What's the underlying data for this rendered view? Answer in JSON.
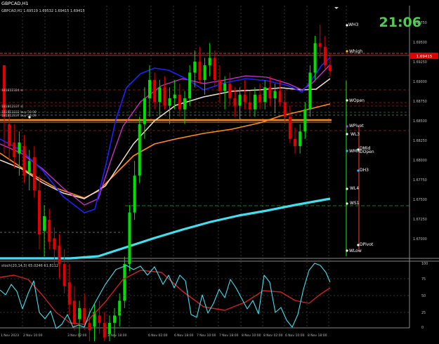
{
  "header": {
    "symbol_title": "GBPCAD,H1",
    "ohlc_text": "GBPCAD,H1  1.69519 1.69532 1.69415 1.69415"
  },
  "clock": {
    "time": "21:06"
  },
  "oscillator": {
    "label": "stoch(20,14,3) 65.0246 61.8112"
  },
  "trade_labels": [
    "181812324 sl",
    "181812337 sl",
    "181812322 buy 50.09",
    "181812337 buy 50.09"
  ],
  "level_labels": [
    "WH3",
    "Whigh",
    "WOpen",
    "WPivot",
    "WL3",
    "WMid",
    "DMid",
    "DOpen",
    "DH3",
    "WL4",
    "WS1",
    "DPivot",
    "WLow"
  ],
  "price_axis": [
    "1.69750",
    "1.69500",
    "1.69250",
    "1.69000",
    "1.68750",
    "1.68500",
    "1.68250",
    "1.68000",
    "1.67750",
    "1.67500",
    "1.67250",
    "1.67000"
  ],
  "current_price": "1.69415",
  "osc_axis": [
    "100",
    "75",
    "50",
    "25",
    "0"
  ],
  "time_axis": [
    "1 Nov 2023",
    "2 Nov 10:00",
    "3 Nov 02:00",
    "3 Nov 18:00",
    "6 Nov 02:00",
    "6 Nov 18:00",
    "7 Nov 10:00",
    "7 Nov 18:00",
    "8 Nov 10:00",
    "8 Nov 02:00",
    "6 Nov 10:00",
    "8 Nov 18:00"
  ],
  "colors": {
    "bull": "#00e000",
    "bear": "#e00000",
    "ma_blue": "#2020ff",
    "ma_magenta": "#d030d0",
    "ma_white": "#f0e0d0",
    "ma_orange": "#ff8c1a",
    "ma_cyan": "#40e0f0",
    "clock": "#4cd04c"
  },
  "chart_data": {
    "type": "candlestick",
    "candles": [
      [
        1.695,
        1.69,
        1.683,
        1.688
      ],
      [
        1.687,
        1.689,
        1.682,
        1.684
      ],
      [
        1.6845,
        1.687,
        1.681,
        1.6825
      ],
      [
        1.683,
        1.686,
        1.68,
        1.6845
      ],
      [
        1.684,
        1.6855,
        1.679,
        1.68
      ],
      [
        1.6805,
        1.6835,
        1.678,
        1.682
      ],
      [
        1.6825,
        1.684,
        1.677,
        1.678
      ],
      [
        1.678,
        1.68,
        1.67,
        1.672
      ],
      [
        1.6725,
        1.676,
        1.669,
        1.6745
      ],
      [
        1.674,
        1.6755,
        1.67,
        1.671
      ],
      [
        1.6715,
        1.673,
        1.668,
        1.67
      ],
      [
        1.6705,
        1.672,
        1.666,
        1.668
      ],
      [
        1.668,
        1.67,
        1.664,
        1.665
      ],
      [
        1.6655,
        1.668,
        1.661,
        1.6625
      ],
      [
        1.663,
        1.665,
        1.659,
        1.66
      ],
      [
        1.6605,
        1.663,
        1.658,
        1.662
      ],
      [
        1.662,
        1.664,
        1.659,
        1.66
      ],
      [
        1.66,
        1.662,
        1.657,
        1.659
      ],
      [
        1.6595,
        1.6625,
        1.6575,
        1.6615
      ],
      [
        1.661,
        1.663,
        1.6585,
        1.66
      ],
      [
        1.66,
        1.6615,
        1.657,
        1.658
      ],
      [
        1.6585,
        1.661,
        1.6565,
        1.66
      ],
      [
        1.66,
        1.662,
        1.658,
        1.661
      ],
      [
        1.661,
        1.664,
        1.6595,
        1.663
      ],
      [
        1.663,
        1.669,
        1.662,
        1.668
      ],
      [
        1.668,
        1.676,
        1.667,
        1.675
      ],
      [
        1.675,
        1.682,
        1.674,
        1.68
      ],
      [
        1.68,
        1.688,
        1.679,
        1.687
      ],
      [
        1.687,
        1.692,
        1.685,
        1.6905
      ],
      [
        1.6905,
        1.695,
        1.688,
        1.693
      ],
      [
        1.693,
        1.694,
        1.689,
        1.69
      ],
      [
        1.69,
        1.693,
        1.688,
        1.692
      ],
      [
        1.692,
        1.6935,
        1.689,
        1.6895
      ],
      [
        1.6895,
        1.692,
        1.687,
        1.6905
      ],
      [
        1.6905,
        1.693,
        1.689,
        1.691
      ],
      [
        1.691,
        1.6925,
        1.688,
        1.689
      ],
      [
        1.689,
        1.6915,
        1.687,
        1.6905
      ],
      [
        1.6905,
        1.695,
        1.6895,
        1.694
      ],
      [
        1.694,
        1.697,
        1.692,
        1.6955
      ],
      [
        1.6955,
        1.6975,
        1.6925,
        1.693
      ],
      [
        1.693,
        1.696,
        1.691,
        1.695
      ],
      [
        1.695,
        1.698,
        1.6935,
        1.696
      ],
      [
        1.696,
        1.697,
        1.692,
        1.693
      ],
      [
        1.693,
        1.695,
        1.69,
        1.6915
      ],
      [
        1.6915,
        1.6935,
        1.689,
        1.6925
      ],
      [
        1.6925,
        1.694,
        1.6895,
        1.6905
      ],
      [
        1.6905,
        1.692,
        1.688,
        1.6895
      ],
      [
        1.6895,
        1.692,
        1.6875,
        1.691
      ],
      [
        1.691,
        1.693,
        1.689,
        1.69
      ],
      [
        1.69,
        1.6915,
        1.688,
        1.689
      ],
      [
        1.689,
        1.692,
        1.688,
        1.691
      ],
      [
        1.691,
        1.6925,
        1.689,
        1.69
      ],
      [
        1.69,
        1.693,
        1.689,
        1.692
      ],
      [
        1.692,
        1.6935,
        1.6895,
        1.6905
      ],
      [
        1.6905,
        1.6925,
        1.6885,
        1.6915
      ],
      [
        1.6915,
        1.693,
        1.6895,
        1.69
      ],
      [
        1.69,
        1.6915,
        1.687,
        1.688
      ],
      [
        1.688,
        1.6895,
        1.6845,
        1.685
      ],
      [
        1.685,
        1.6865,
        1.683,
        1.684
      ],
      [
        1.684,
        1.687,
        1.683,
        1.686
      ],
      [
        1.686,
        1.69,
        1.685,
        1.689
      ],
      [
        1.689,
        1.695,
        1.688,
        1.694
      ],
      [
        1.694,
        1.699,
        1.693,
        1.698
      ],
      [
        1.698,
        1.7005,
        1.696,
        1.6975
      ],
      [
        1.6975,
        1.699,
        1.6945,
        1.695
      ],
      [
        1.695,
        1.6965,
        1.6935,
        1.6942
      ]
    ],
    "ylim": [
      1.67,
      1.701
    ]
  }
}
